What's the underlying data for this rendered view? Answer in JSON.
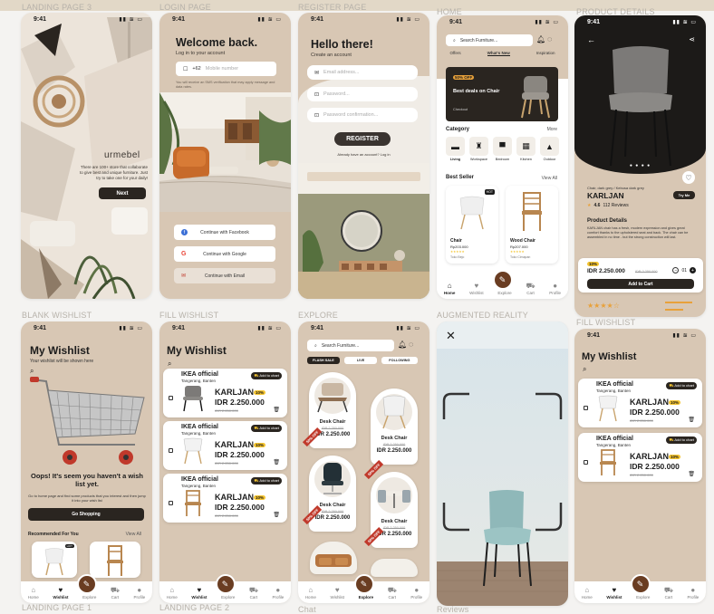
{
  "labels": {
    "landing": "LANDING PAGE 3",
    "login": "LOGIN PAGE",
    "register": "REGISTER PAGE",
    "home": "HOME",
    "product": "PRODUCT DETAILS",
    "blank": "BLANK WISHLIST",
    "fill": "FILL WISHLIST",
    "explore": "EXPLORE",
    "ar": "AUGMENTED REALITY",
    "fill2": "FILL WISHLIST",
    "landing1": "LANDING PAGE 1",
    "landing2": "LANDING PAGE 2",
    "chat": "Chat",
    "reviews": "Reviews"
  },
  "time": "9:41",
  "landing": {
    "brand": "urmebel",
    "text": "There are 100+ store that collaborate to give best and unique furniture. Just try to take one for your daily!",
    "button": "Next"
  },
  "login": {
    "title": "Welcome back.",
    "subtitle": "Log in to your account",
    "code": "+62",
    "phone_ph": "Mobile number",
    "hint": "You will receive an SMS verification that may apply message and data rates.",
    "facebook": "Continue with Facebook",
    "google": "Continue with Google",
    "email": "Continue with Email"
  },
  "register": {
    "title": "Hello there!",
    "subtitle": "Create an account",
    "email_ph": "Email address...",
    "pass_ph": "Password...",
    "confirm_ph": "Password confirmation...",
    "button": "REGISTER",
    "login_text": "Already have an account? Log in"
  },
  "home": {
    "search_ph": "Search Furniture...",
    "tabs": [
      "Offers",
      "What's New",
      "Inspiration"
    ],
    "promo_tag": "50% OFF",
    "promo_title": "Best deals on Chair",
    "promo_btn": "Checkout",
    "category": "Category",
    "more": "More",
    "categories": [
      "Living",
      "Workspace",
      "Bedroom",
      "Kitchen",
      "Outdoor"
    ],
    "bestseller": "Best Seller",
    "viewall": "View All",
    "products": [
      {
        "name": "Chair",
        "price": "Rp203.000",
        "tag": "HOT",
        "shop": "Toko Bejo"
      },
      {
        "name": "Wood Chair",
        "price": "Rp207.000",
        "shop": "Toko Cimapan"
      }
    ]
  },
  "nav": {
    "home": "Home",
    "wishlist": "Wishlist",
    "explore": "Explore",
    "cart": "Cart",
    "profile": "Profile"
  },
  "product": {
    "color": "Chair, dark grey / Kebusa dark grey",
    "name": "KARLJAN",
    "try": "Try Me",
    "rating": "4.6",
    "reviews": "112 Reviews",
    "details_title": "Product Details",
    "details": "KARLJAN chair has a fresh, modern expression and gives great comfort thanks to the upholstered seat and back. The chair can be assembled in no time - but the strong construction will last.",
    "discount": "10%",
    "price": "IDR 2.250.000",
    "old_price": "IDR 2.250.000",
    "qty": "01",
    "add": "Add to Cart"
  },
  "blank": {
    "title": "My Wishlist",
    "subtitle": "Your wishlist will be shown here",
    "oops": "Oops! It's seem you haven't a wish list yet.",
    "hint": "Go to home page and find some products that you interest and then jump it into your wish list",
    "button": "Go Shopping",
    "recommended": "Recommended For You",
    "viewall": "View All"
  },
  "wish": {
    "title": "My Wishlist",
    "store": "IKEA official",
    "city": "Tangerang, Banten",
    "add": "Add to chart",
    "name": "KARLJAN",
    "discount": "10%",
    "price": "IDR 2.250.000",
    "old": "IDR 2.250.000"
  },
  "explore": {
    "search_ph": "Search Furniture...",
    "tabs": [
      "FLASH SALE",
      "LIVE",
      "FOLLOWING"
    ],
    "items": [
      {
        "name": "Desk Chair",
        "old": "IDR 2.250.000",
        "price": "IDR 2.250.000",
        "badge": "50% OFF"
      },
      {
        "name": "Desk Chair",
        "old": "IDR 2.250.000",
        "price": "IDR 2.250.000"
      },
      {
        "name": "Desk Chair",
        "old": "IDR 2.250.000",
        "price": "IDR 2.250.000",
        "badge": "50% OFF"
      },
      {
        "name": "Desk Chair",
        "old": "IDR 2.250.000",
        "price": "IDR 2.250.000",
        "badge": "50% OFF"
      }
    ]
  },
  "colors": {
    "brown": "#6a3d22",
    "beige": "#d8c7b4",
    "dark": "#2a2520",
    "yellow": "#f4c430"
  }
}
